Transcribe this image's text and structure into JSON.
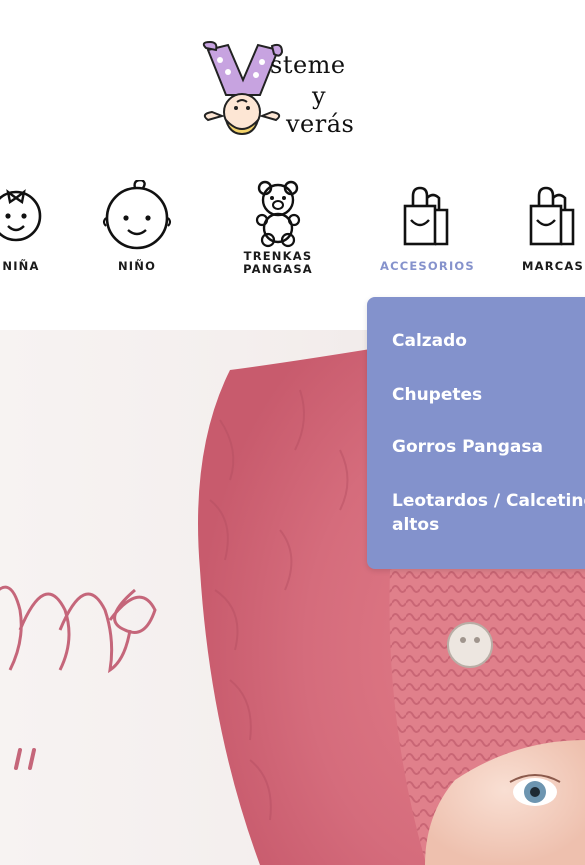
{
  "logo": {
    "line1": "steme",
    "line2": "y",
    "line3": "verás"
  },
  "nav": {
    "items": [
      {
        "label": "NIÑA",
        "icon": "girl-face-icon"
      },
      {
        "label": "NIÑO",
        "icon": "boy-face-icon"
      },
      {
        "label": "TRENKAS",
        "label2": "PANGASA",
        "icon": "teddy-bear-icon"
      },
      {
        "label": "ACCESORIOS",
        "icon": "shopping-bag-icon",
        "active": true
      },
      {
        "label": "MARCAS",
        "icon": "shopping-bag-icon"
      }
    ],
    "active_color": "#8592cc"
  },
  "dropdown": {
    "background": "#8392cc",
    "items": [
      {
        "label": "Calzado"
      },
      {
        "label": "Chupetes"
      },
      {
        "label": "Gorros Pangasa"
      },
      {
        "label": "Leotardos / Calcetines",
        "label2": "altos"
      }
    ]
  },
  "hero": {
    "script_text_1": "ms",
    "script_text_2": "\""
  }
}
